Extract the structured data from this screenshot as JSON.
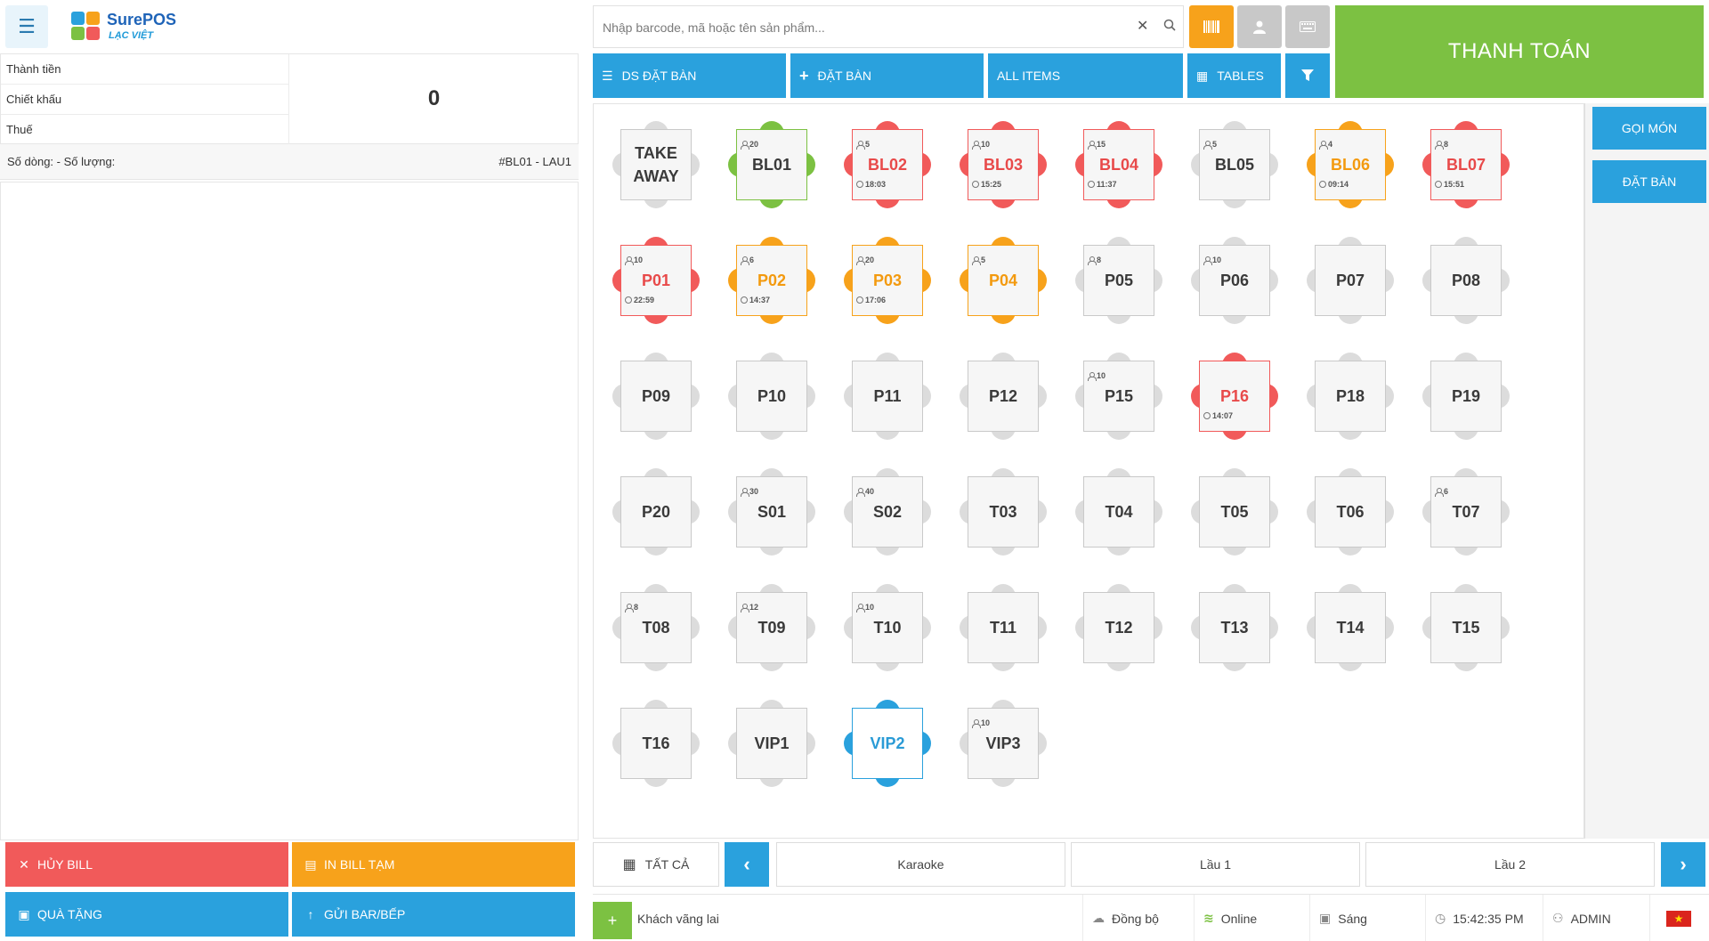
{
  "brand": {
    "name": "SurePOS",
    "tagline": "LẠC VIỆT",
    "colors": [
      "#2aa1dd",
      "#7cc142",
      "#f7a21b",
      "#f15a5a"
    ]
  },
  "order": {
    "thanh_tien_label": "Thành tiền",
    "chiet_khau_label": "Chiết khấu",
    "thue_label": "Thuế",
    "total_value": "0",
    "lines_label": "Số dòng: - Số lượng:",
    "table_ref": "#BL01 - LAU1"
  },
  "left_actions": {
    "cancel_bill": "HỦY BILL",
    "print_temp": "IN BILL TẠM",
    "gift": "QUÀ TẶNG",
    "send_kitchen": "GỬI BAR/BẾP"
  },
  "search": {
    "placeholder": "Nhập barcode, mã hoặc tên sản phẩm..."
  },
  "pay_label": "THANH TOÁN",
  "toolbar": {
    "booking_list": "DS ĐẶT BÀN",
    "booking_add": "ĐẶT BÀN",
    "all_items": "ALL ITEMS",
    "tables": "TABLES"
  },
  "side": {
    "order_btn": "GỌI MÓN",
    "book_btn": "ĐẶT BÀN"
  },
  "status_colors": {
    "red": "#f15a5a",
    "orange": "#f7a21b",
    "green": "#7cc142",
    "blue": "#2aa1dd",
    "free": "#dcdcdc"
  },
  "tables": [
    {
      "name": "TAKE AWAY",
      "status": "free",
      "pax": "",
      "time": ""
    },
    {
      "name": "BL01",
      "status": "green",
      "pax": "20",
      "time": ""
    },
    {
      "name": "BL02",
      "status": "red",
      "pax": "5",
      "time": "18:03"
    },
    {
      "name": "BL03",
      "status": "red",
      "pax": "10",
      "time": "15:25"
    },
    {
      "name": "BL04",
      "status": "red",
      "pax": "15",
      "time": "11:37"
    },
    {
      "name": "BL05",
      "status": "free",
      "pax": "5",
      "time": ""
    },
    {
      "name": "BL06",
      "status": "orange",
      "pax": "4",
      "time": "09:14"
    },
    {
      "name": "BL07",
      "status": "red",
      "pax": "8",
      "time": "15:51"
    },
    {
      "name": "P01",
      "status": "red",
      "pax": "10",
      "time": "22:59"
    },
    {
      "name": "P02",
      "status": "orange",
      "pax": "6",
      "time": "14:37"
    },
    {
      "name": "P03",
      "status": "orange",
      "pax": "20",
      "time": "17:06"
    },
    {
      "name": "P04",
      "status": "orange",
      "pax": "5",
      "time": ""
    },
    {
      "name": "P05",
      "status": "free",
      "pax": "8",
      "time": ""
    },
    {
      "name": "P06",
      "status": "free",
      "pax": "10",
      "time": ""
    },
    {
      "name": "P07",
      "status": "free",
      "pax": "",
      "time": ""
    },
    {
      "name": "P08",
      "status": "free",
      "pax": "",
      "time": ""
    },
    {
      "name": "P09",
      "status": "free",
      "pax": "",
      "time": ""
    },
    {
      "name": "P10",
      "status": "free",
      "pax": "",
      "time": ""
    },
    {
      "name": "P11",
      "status": "free",
      "pax": "",
      "time": ""
    },
    {
      "name": "P12",
      "status": "free",
      "pax": "",
      "time": ""
    },
    {
      "name": "P15",
      "status": "free",
      "pax": "10",
      "time": ""
    },
    {
      "name": "P16",
      "status": "red",
      "pax": "",
      "time": "14:07"
    },
    {
      "name": "P18",
      "status": "free",
      "pax": "",
      "time": ""
    },
    {
      "name": "P19",
      "status": "free",
      "pax": "",
      "time": ""
    },
    {
      "name": "P20",
      "status": "free",
      "pax": "",
      "time": ""
    },
    {
      "name": "S01",
      "status": "free",
      "pax": "30",
      "time": ""
    },
    {
      "name": "S02",
      "status": "free",
      "pax": "40",
      "time": ""
    },
    {
      "name": "T03",
      "status": "free",
      "pax": "",
      "time": ""
    },
    {
      "name": "T04",
      "status": "free",
      "pax": "",
      "time": ""
    },
    {
      "name": "T05",
      "status": "free",
      "pax": "",
      "time": ""
    },
    {
      "name": "T06",
      "status": "free",
      "pax": "",
      "time": ""
    },
    {
      "name": "T07",
      "status": "free",
      "pax": "6",
      "time": ""
    },
    {
      "name": "T08",
      "status": "free",
      "pax": "8",
      "time": ""
    },
    {
      "name": "T09",
      "status": "free",
      "pax": "12",
      "time": ""
    },
    {
      "name": "T10",
      "status": "free",
      "pax": "10",
      "time": ""
    },
    {
      "name": "T11",
      "status": "free",
      "pax": "",
      "time": ""
    },
    {
      "name": "T12",
      "status": "free",
      "pax": "",
      "time": ""
    },
    {
      "name": "T13",
      "status": "free",
      "pax": "",
      "time": ""
    },
    {
      "name": "T14",
      "status": "free",
      "pax": "",
      "time": ""
    },
    {
      "name": "T15",
      "status": "free",
      "pax": "",
      "time": ""
    },
    {
      "name": "T16",
      "status": "free",
      "pax": "",
      "time": ""
    },
    {
      "name": "VIP1",
      "status": "free",
      "pax": "",
      "time": ""
    },
    {
      "name": "VIP2",
      "status": "blue",
      "pax": "",
      "time": ""
    },
    {
      "name": "VIP3",
      "status": "free",
      "pax": "10",
      "time": ""
    }
  ],
  "floors": {
    "all_label": "TẤT CẢ",
    "items": [
      "Karaoke",
      "Lầu 1",
      "Lầu 2"
    ]
  },
  "statusbar": {
    "customer": "Khách vãng lai",
    "sync": "Đồng bộ",
    "online": "Online",
    "shift": "Sáng",
    "clock": "15:42:35 PM",
    "user": "ADMIN"
  }
}
